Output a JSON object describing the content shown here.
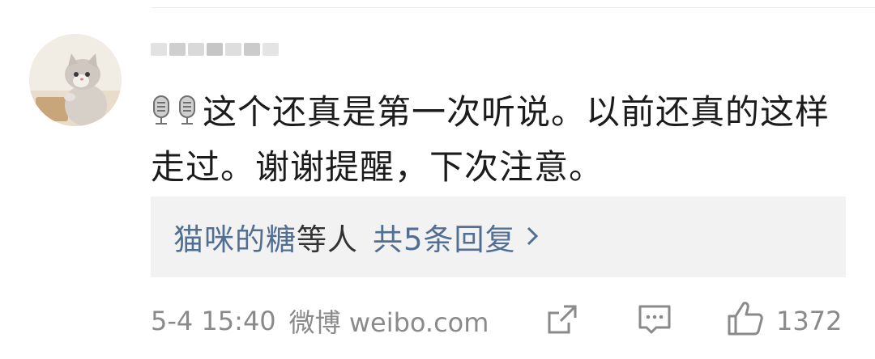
{
  "comment": {
    "text": "这个还真是第一次听说。以前还真的这样走过。谢谢提醒，下次注意。",
    "emoji_icons": [
      "microphone-icon",
      "microphone-icon"
    ]
  },
  "replies": {
    "name": "猫咪的糖",
    "suffix": "等人",
    "count_label": "共5条回复",
    "chevron": "chevron-right-icon"
  },
  "footer": {
    "timestamp": "5-4 15:40",
    "source": "微博 weibo.com",
    "like_count": "1372",
    "icons": [
      "share-icon",
      "comment-icon",
      "thumbs-up-icon"
    ]
  },
  "colors": {
    "link": "#516f93",
    "meta": "#8a8a8a",
    "reply_bg": "#f2f2f2"
  }
}
